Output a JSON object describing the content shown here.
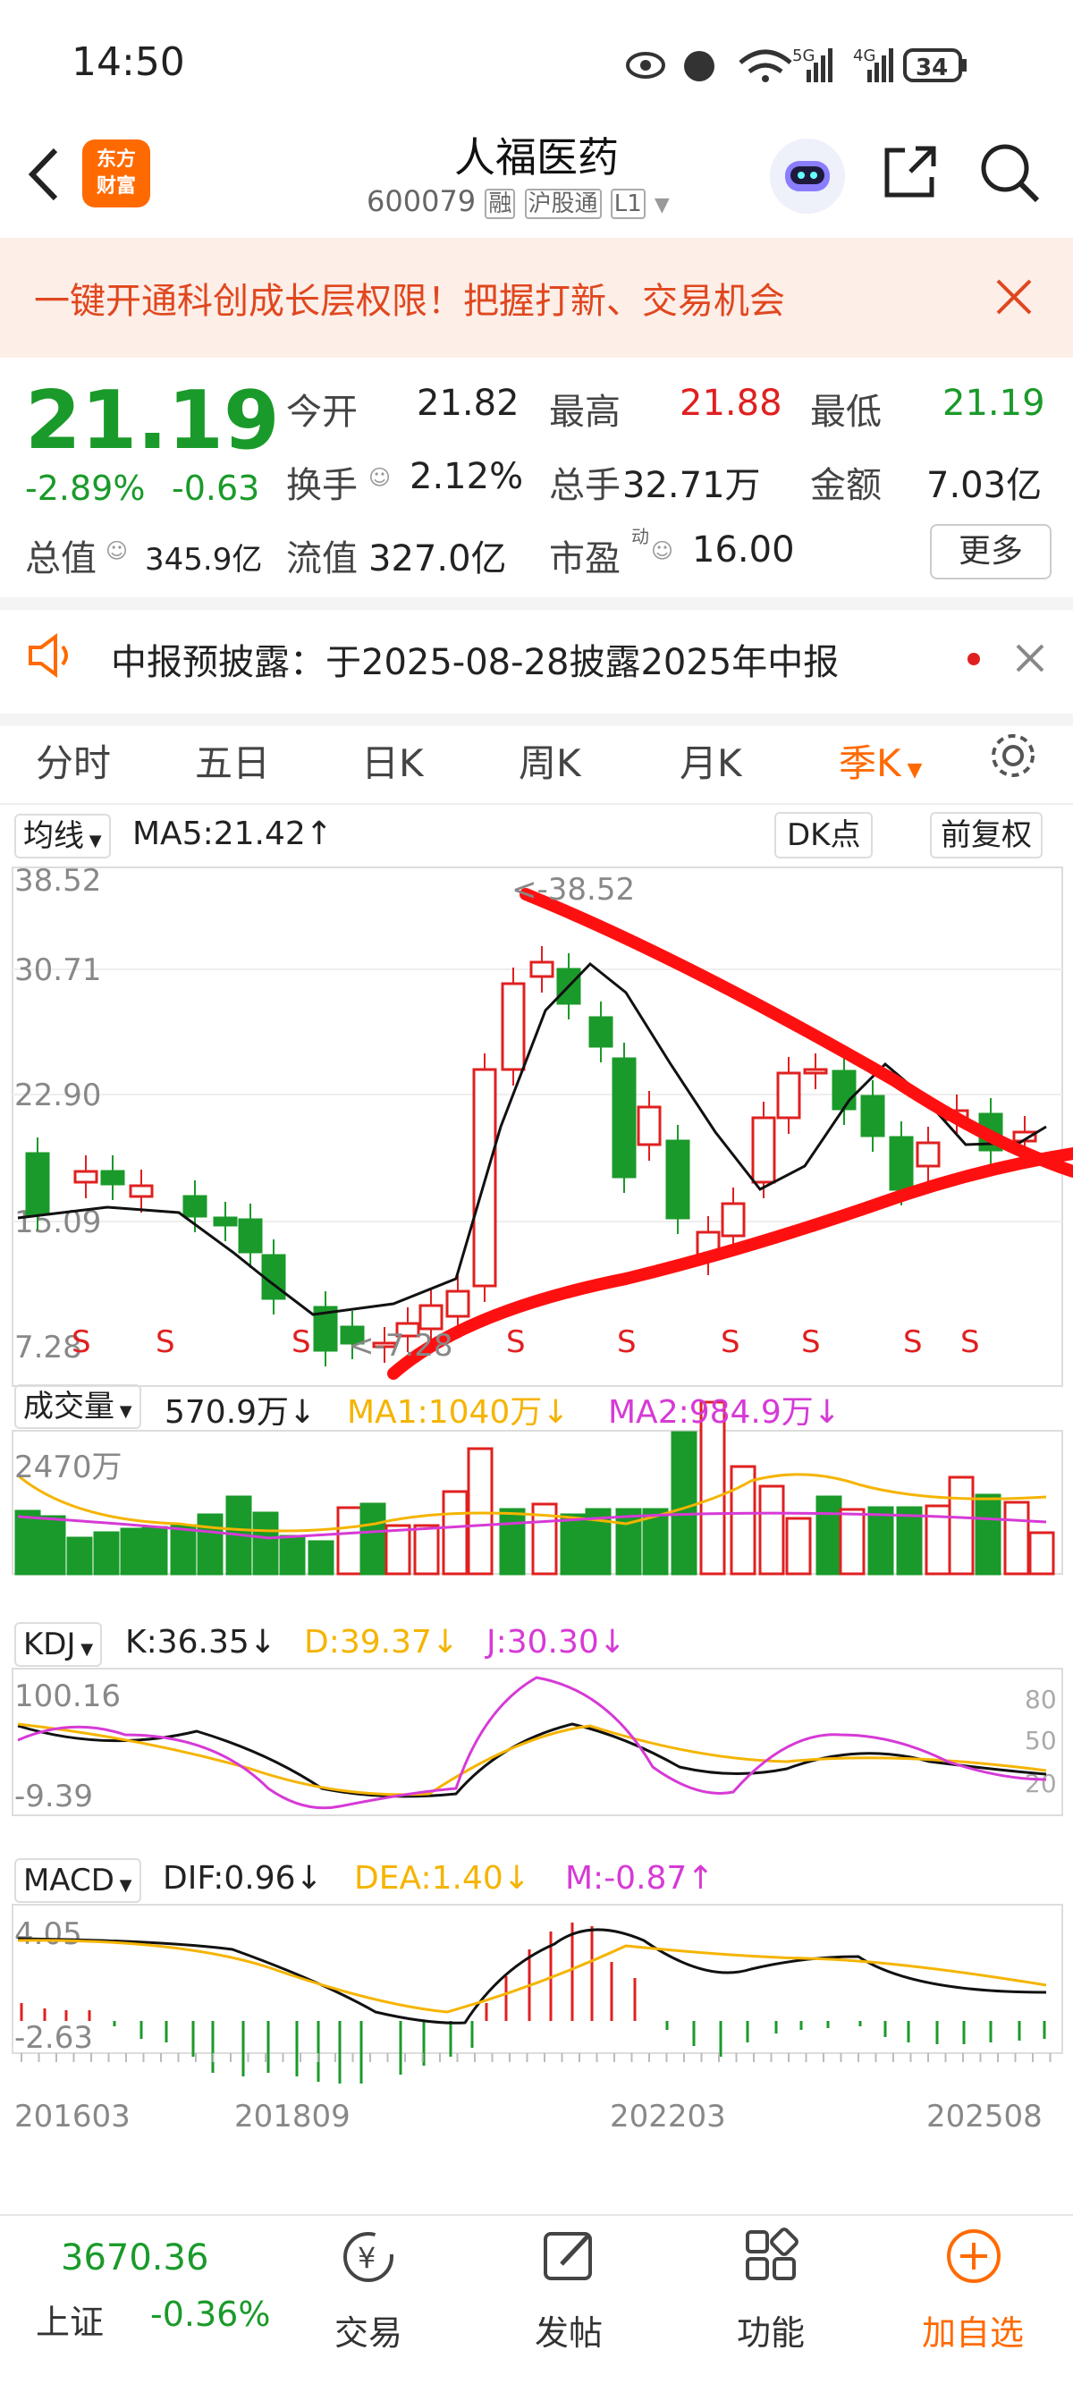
{
  "status": {
    "time": "14:50",
    "net1": "5G",
    "net2": "4G",
    "battery": "34"
  },
  "header": {
    "logo_line1": "东方",
    "logo_line2": "财富",
    "title": "人福医药",
    "code": "600079",
    "tag1": "融",
    "tag2": "沪股通",
    "tag3": "L1"
  },
  "banner": {
    "text": "一键开通科创成长层权限！把握打新、交易机会"
  },
  "quote": {
    "price": "21.19",
    "pct": "-2.89%",
    "change": "-0.63",
    "open_label": "今开",
    "open": "21.82",
    "high_label": "最高",
    "high": "21.88",
    "low_label": "最低",
    "low": "21.19",
    "turnover_label": "换手",
    "turnover": "2.12%",
    "volume_label": "总手",
    "volume": "32.71万",
    "amount_label": "金额",
    "amount": "7.03亿",
    "mktcap_label": "总值",
    "mktcap": "345.9亿",
    "float_label": "流值",
    "float": "327.0亿",
    "pe_label": "市盈",
    "pe_sup": "动",
    "pe": "16.00",
    "more": "更多"
  },
  "notice": {
    "text": "中报预披露：于2025-08-28披露2025年中报"
  },
  "tabs": [
    "分时",
    "五日",
    "日K",
    "周K",
    "月K",
    "季K"
  ],
  "chart": {
    "ma_selector": "均线",
    "ma5": "MA5:21.42↑",
    "dk": "DK点",
    "adjust": "前复权",
    "price_ticks": [
      "38.52",
      "30.71",
      "22.90",
      "15.09",
      "7.28"
    ],
    "max_label": "<-38.52",
    "min_label": "<-7.28",
    "vol_selector": "成交量",
    "vol": "570.9万↓",
    "vol_ma1": "MA1:1040万↓",
    "vol_ma2": "MA2:984.9万↓",
    "vol_tick": "2470万",
    "kdj_selector": "KDJ",
    "kdj_k": "K:36.35↓",
    "kdj_d": "D:39.37↓",
    "kdj_j": "J:30.30↓",
    "kdj_top": "100.16",
    "kdj_bottom": "-9.39",
    "kdj_r1": "80",
    "kdj_r2": "50",
    "kdj_r3": "20",
    "macd_selector": "MACD",
    "macd_dif": "DIF:0.96↓",
    "macd_dea": "DEA:1.40↓",
    "macd_m": "M:-0.87↑",
    "macd_top": "4.05",
    "macd_bottom": "-2.63",
    "dates": [
      "201603",
      "201809",
      "202203",
      "202508"
    ]
  },
  "index_bar": {
    "value": "3670.36",
    "name": "上证",
    "pct": "-0.36%"
  },
  "bottom_nav": [
    "交易",
    "发帖",
    "功能",
    "加自选"
  ],
  "colors": {
    "up": "#e02020",
    "down": "#1a9a2a",
    "accent": "#ff6a00",
    "ma1": "#f5b400",
    "ma2": "#d63ad6"
  }
}
